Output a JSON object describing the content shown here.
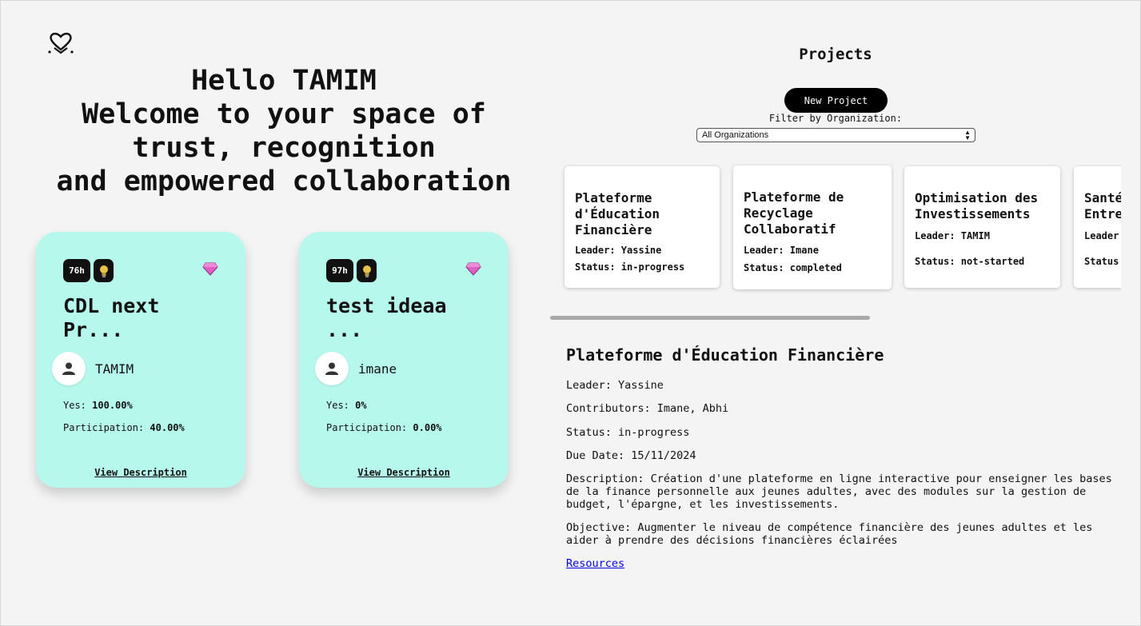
{
  "greeting": {
    "lines": [
      "Hello TAMIM",
      "Welcome to your space of",
      "trust, recognition",
      "and empowered collaboration"
    ]
  },
  "ideas": [
    {
      "time": "76h",
      "title": "CDL next\nPr...",
      "author": "TAMIM",
      "yes_label": "Yes:",
      "yes": "100.00%",
      "participation_label": "Participation:",
      "participation": "40.00%",
      "view": "View Description"
    },
    {
      "time": "97h",
      "title": "test ideaa\n...",
      "author": "imane",
      "yes_label": "Yes:",
      "yes": "0%",
      "participation_label": "Participation:",
      "participation": "0.00%",
      "view": "View Description"
    }
  ],
  "projects": {
    "title": "Projects",
    "new_button": "New Project",
    "filter_label": "Filter by Organization:",
    "filter_value": "All Organizations",
    "cards": [
      {
        "title": "Plateforme\nd'Éducation\nFinancière",
        "leader": "Leader: Yassine",
        "status": "Status: in-progress"
      },
      {
        "title": "Plateforme de\nRecyclage\nCollaboratif",
        "leader": "Leader: Imane",
        "status": "Status: completed"
      },
      {
        "title": "Optimisation des\nInvestissements",
        "leader": "Leader: TAMIM",
        "status": "Status: not-started"
      },
      {
        "title": "Santé\nEntre",
        "leader": "Leader:",
        "status": "Status:"
      }
    ]
  },
  "detail": {
    "title": "Plateforme d'Éducation Financière",
    "leader": "Leader: Yassine",
    "contributors": "Contributors: Imane, Abhi",
    "status": "Status: in-progress",
    "due_date": "Due Date: 15/11/2024",
    "description": "Description: Création d'une plateforme en ligne interactive pour enseigner les bases de la finance personnelle aux jeunes adultes, avec des modules sur la gestion de budget, l'épargne, et les investissements.",
    "objective": "Objective: Augmenter le niveau de compétence financière des jeunes adultes et les aider à prendre des décisions financières éclairées",
    "resources": "Resources"
  }
}
